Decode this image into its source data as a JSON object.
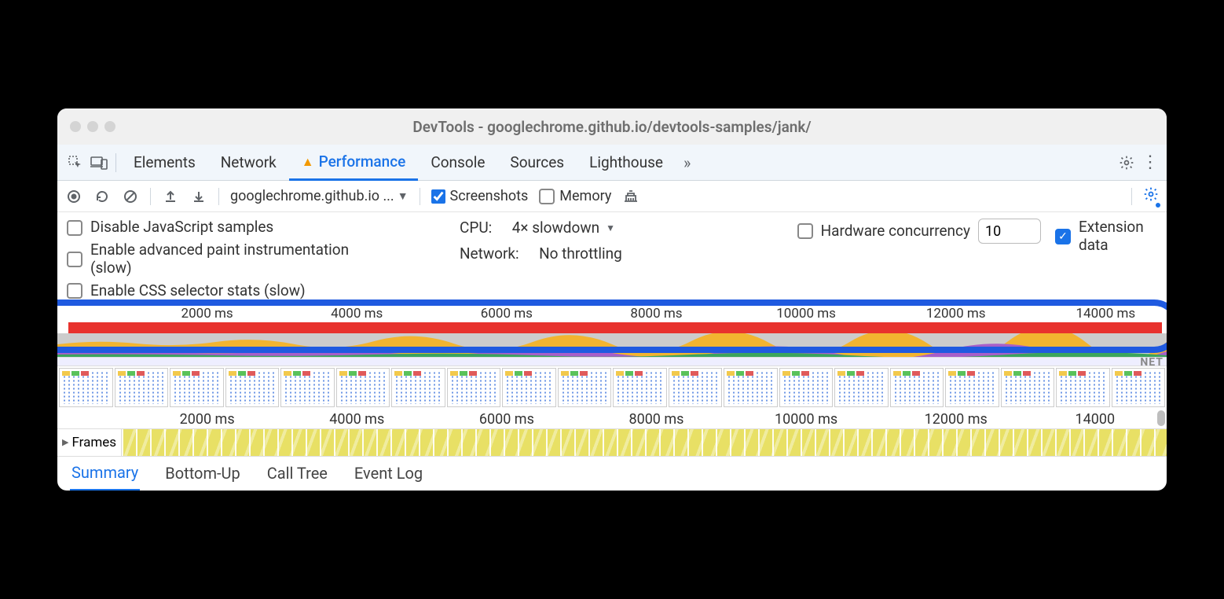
{
  "window": {
    "title": "DevTools - googlechrome.github.io/devtools-samples/jank/"
  },
  "tabs": {
    "items": [
      "Elements",
      "Network",
      "Performance",
      "Console",
      "Sources",
      "Lighthouse"
    ],
    "active": "Performance",
    "more": "»"
  },
  "toolbar": {
    "source": "googlechrome.github.io ...",
    "screenshots_label": "Screenshots",
    "screenshots_checked": true,
    "memory_label": "Memory",
    "memory_checked": false
  },
  "settings": {
    "disable_js_samples": {
      "label": "Disable JavaScript samples",
      "checked": false
    },
    "advanced_paint": {
      "label": "Enable advanced paint instrumentation (slow)",
      "checked": false
    },
    "css_selector_stats": {
      "label": "Enable CSS selector stats (slow)",
      "checked": false
    },
    "cpu": {
      "label": "CPU:",
      "value": "4× slowdown"
    },
    "network": {
      "label": "Network:",
      "value": "No throttling"
    },
    "hw_concurrency": {
      "label": "Hardware concurrency",
      "checked": false,
      "value": "10"
    },
    "extension_data": {
      "label": "Extension data",
      "checked": true
    }
  },
  "timeline": {
    "ticks": [
      "2000 ms",
      "4000 ms",
      "6000 ms",
      "8000 ms",
      "10000 ms",
      "12000 ms",
      "14000 ms"
    ],
    "tick_positions_pct": [
      13.5,
      27,
      40.5,
      54,
      67.5,
      81,
      94.5
    ],
    "net_label": "NET",
    "frames_label": "Frames",
    "filmstrip_count": 20
  },
  "detail_tabs": {
    "items": [
      "Summary",
      "Bottom-Up",
      "Call Tree",
      "Event Log"
    ],
    "active": "Summary"
  }
}
